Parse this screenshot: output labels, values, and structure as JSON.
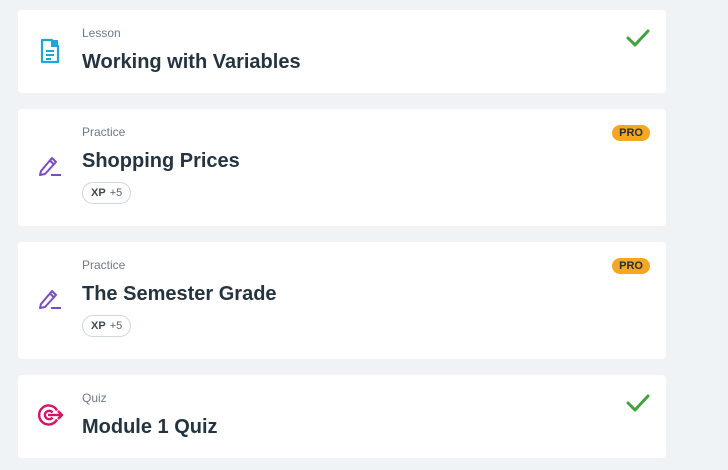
{
  "items": [
    {
      "type": "Lesson",
      "title": "Working with Variables",
      "icon": "document-icon",
      "status": "completed"
    },
    {
      "type": "Practice",
      "title": "Shopping Prices",
      "icon": "pencil-icon",
      "badge": "PRO",
      "xp_key": "XP",
      "xp_value": "+5"
    },
    {
      "type": "Practice",
      "title": "The Semester Grade",
      "icon": "pencil-icon",
      "badge": "PRO",
      "xp_key": "XP",
      "xp_value": "+5"
    },
    {
      "type": "Quiz",
      "title": "Module 1 Quiz",
      "icon": "target-icon",
      "status": "completed"
    }
  ],
  "colors": {
    "background": "#f0f3f5",
    "lesson_icon": "#1fa6d9",
    "practice_icon": "#7a4bc4",
    "quiz_icon": "#d6136a",
    "check": "#3ea53a",
    "pro_badge": "#f5a623",
    "title": "#243441"
  }
}
